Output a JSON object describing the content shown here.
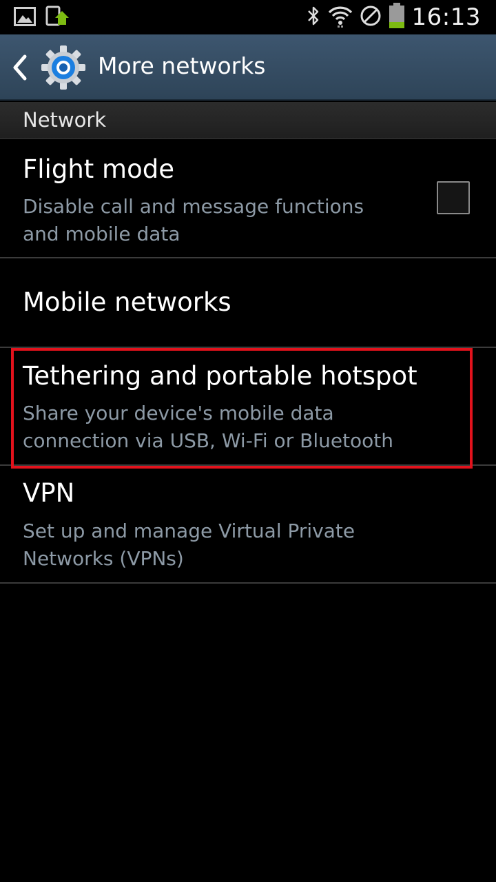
{
  "status_bar": {
    "time": "16:13",
    "left_icons": [
      "gallery-icon",
      "download-sync-icon"
    ],
    "right_icons": [
      "bluetooth-icon",
      "wifi-icon",
      "no-signal-icon",
      "battery-icon"
    ]
  },
  "action_bar": {
    "title": "More networks",
    "back_icon": "chevron-left-icon",
    "app_icon": "settings-gear-icon"
  },
  "section": {
    "header": "Network"
  },
  "items": [
    {
      "title": "Flight mode",
      "subtitle": "Disable call and message functions\nand mobile data",
      "checkbox_checked": false
    },
    {
      "title": "Mobile networks"
    },
    {
      "title": "Tethering and portable hotspot",
      "subtitle": "Share your device's mobile data\nconnection via USB, Wi-Fi or Bluetooth",
      "highlighted": true
    },
    {
      "title": "VPN",
      "subtitle": "Set up and manage Virtual Private\nNetworks (VPNs)"
    }
  ],
  "colors": {
    "action_bar": "#35506a",
    "highlight_border": "#e2121c",
    "subtitle_text": "#8d9aa6",
    "battery_fill": "#7dbb12"
  }
}
